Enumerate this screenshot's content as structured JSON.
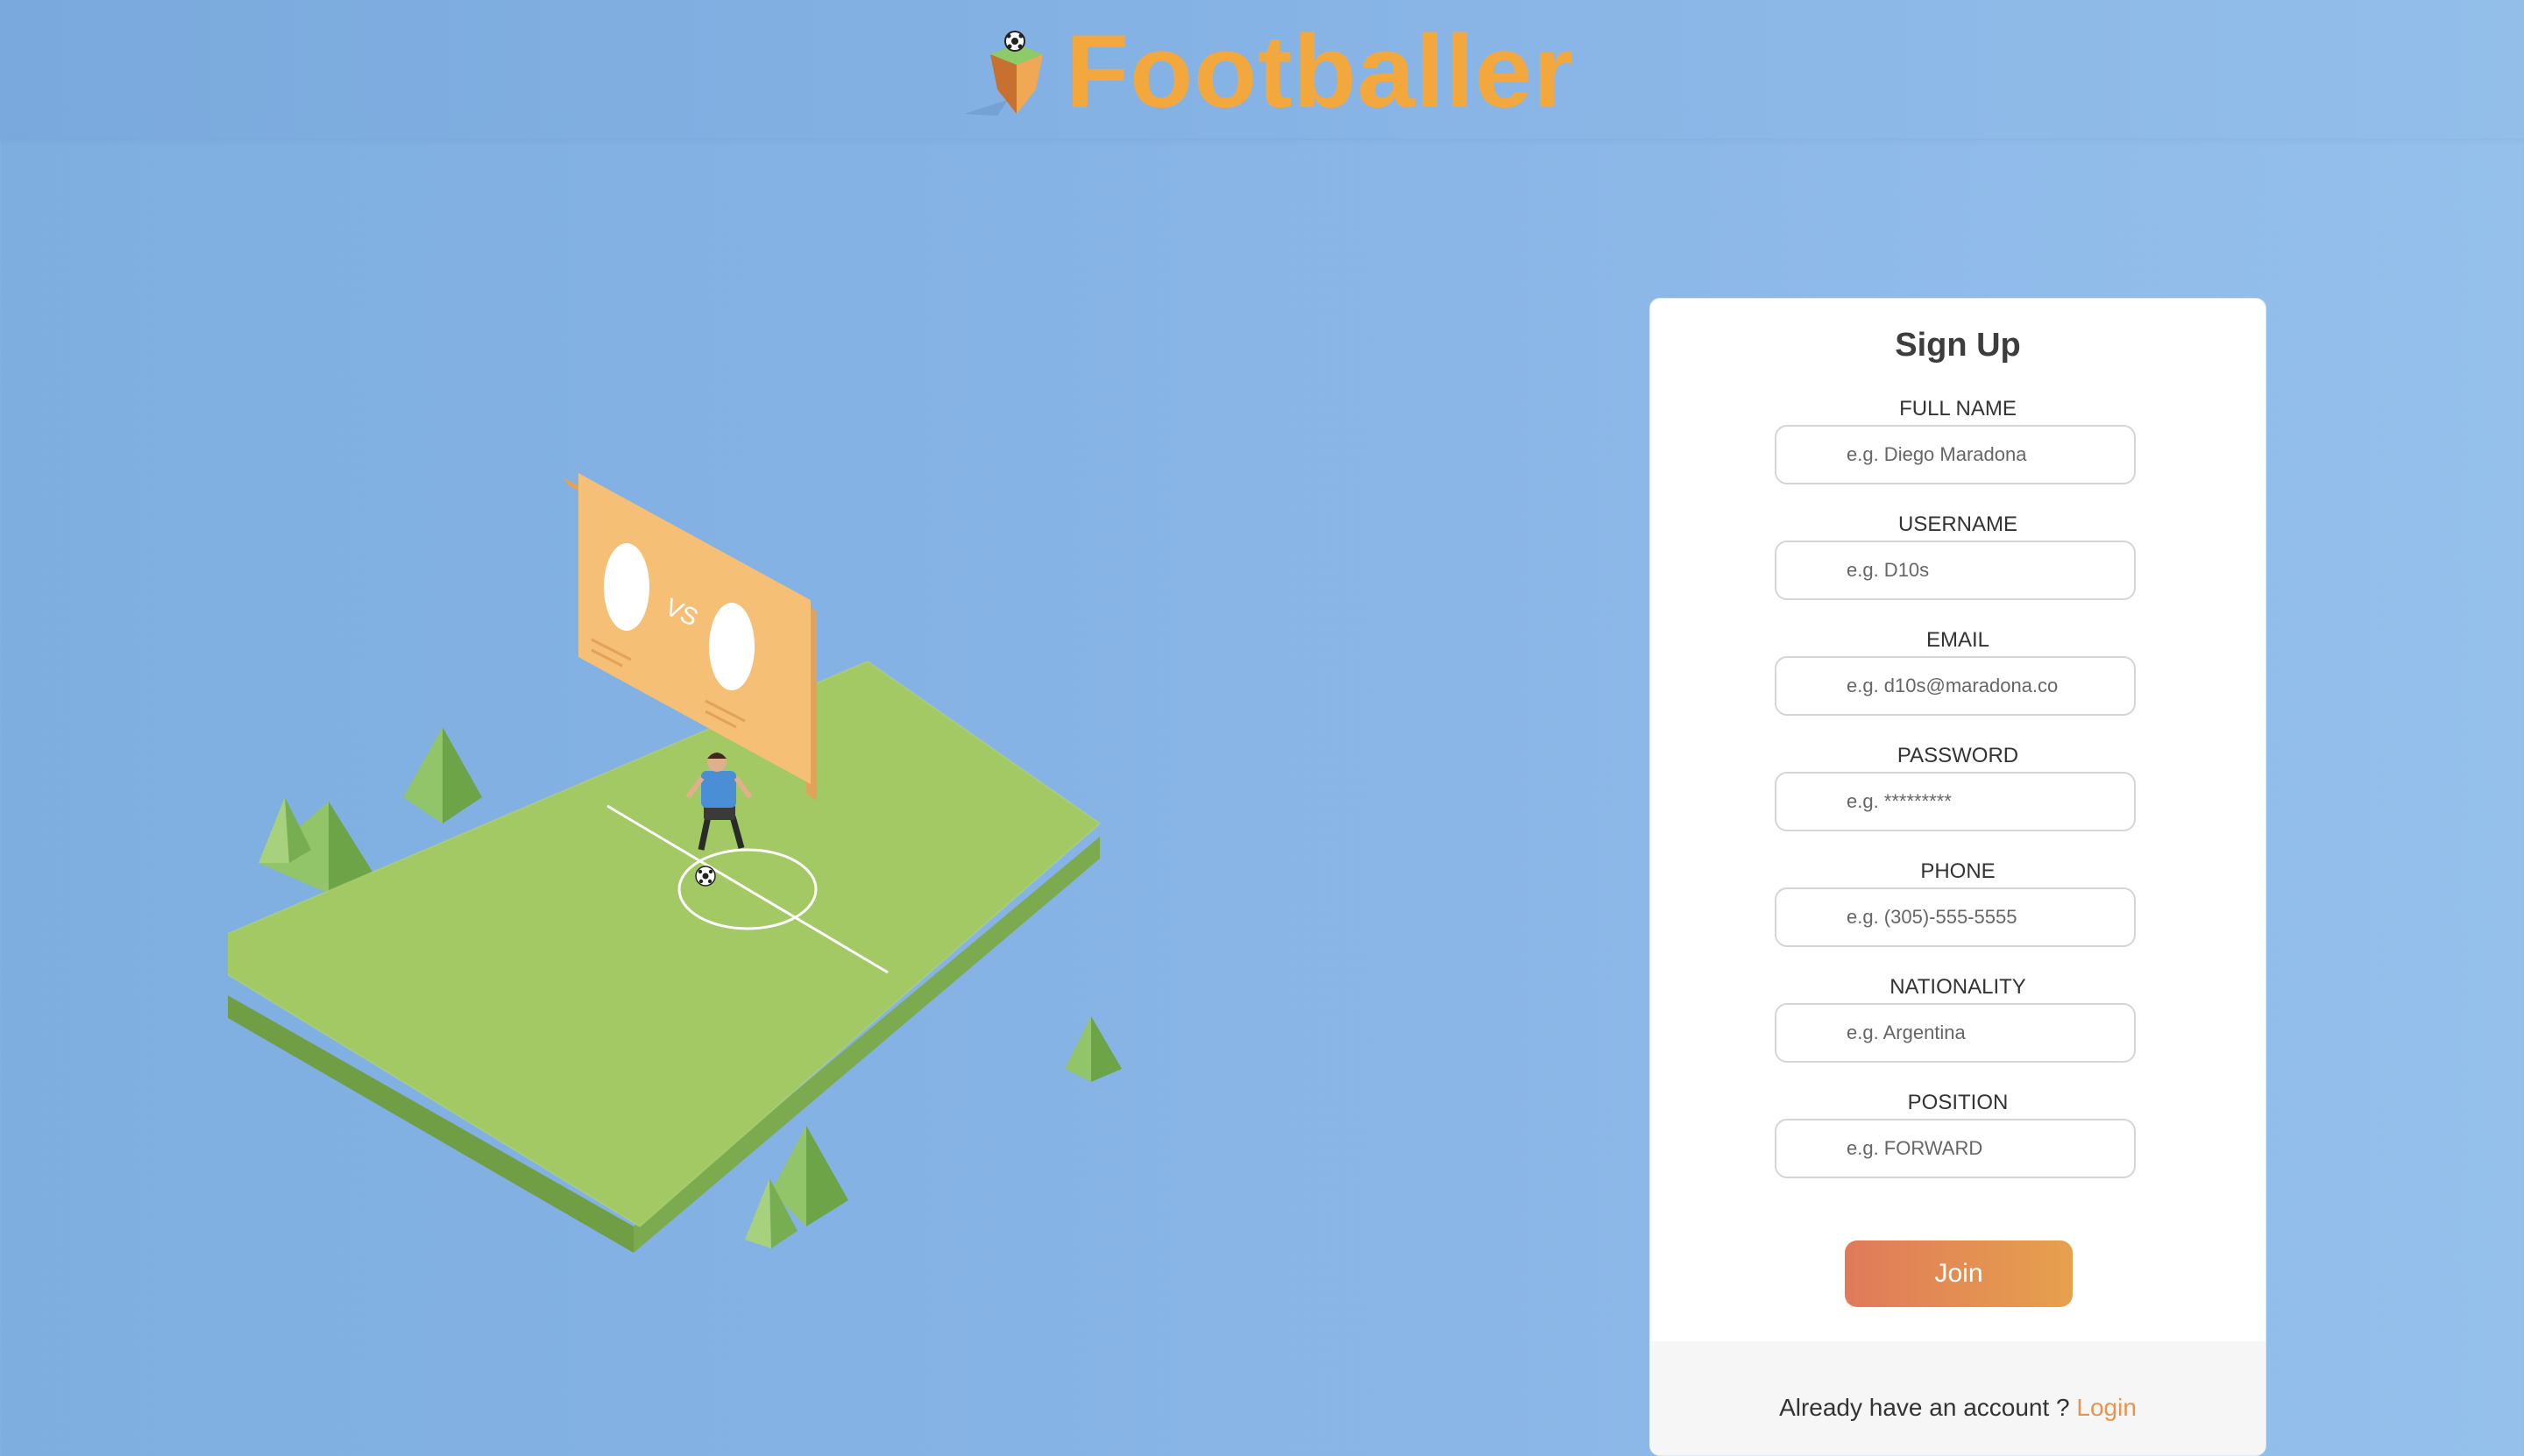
{
  "brand": {
    "name": "Footballer"
  },
  "illustration": {
    "vs_text": "VS"
  },
  "signup": {
    "title": "Sign Up",
    "fields": [
      {
        "label": "FULL NAME",
        "placeholder": "e.g. Diego Maradona"
      },
      {
        "label": "USERNAME",
        "placeholder": "e.g. D10s"
      },
      {
        "label": "EMAIL",
        "placeholder": "e.g. d10s@maradona.co"
      },
      {
        "label": "PASSWORD",
        "placeholder": "e.g. *********"
      },
      {
        "label": "PHONE",
        "placeholder": "e.g. (305)-555-5555"
      },
      {
        "label": "NATIONALITY",
        "placeholder": "e.g. Argentina"
      },
      {
        "label": "POSITION",
        "placeholder": "e.g. FORWARD"
      }
    ],
    "join_label": "Join",
    "footer_text": "Already have an account ?",
    "login_label": "Login"
  },
  "colors": {
    "background": "#88b4e6",
    "brand": "#f3a83e",
    "field_green": "#a2c964",
    "scoreboard": "#f5bf76",
    "button_start": "#e07a5a",
    "button_end": "#e6a14d",
    "link": "#e89450"
  }
}
